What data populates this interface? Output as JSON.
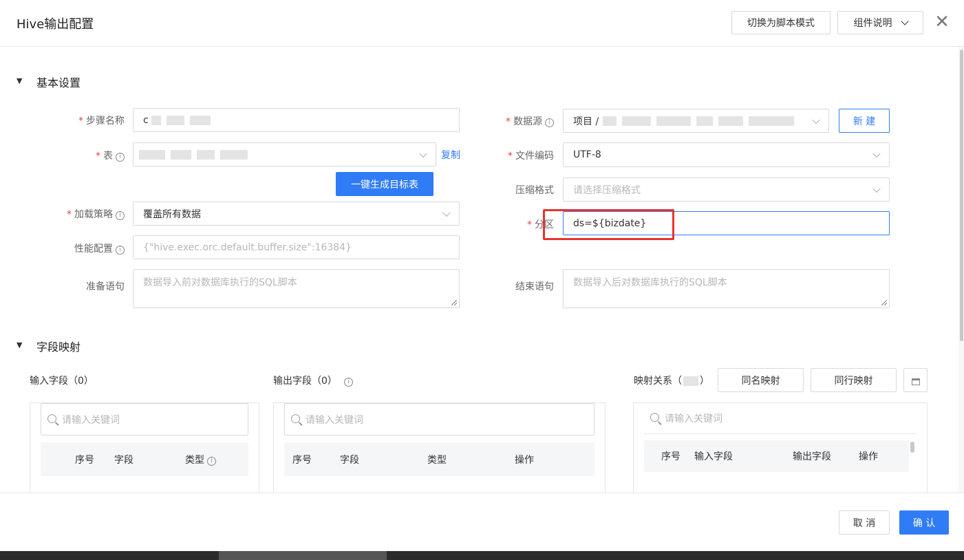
{
  "header": {
    "title": "Hive输出配置",
    "script_mode_label": "切换为脚本模式",
    "component_help_label": "组件说明",
    "close_glyph": "✕"
  },
  "basic": {
    "section_title": "基本设置",
    "step_name": {
      "label": "步骤名称",
      "value_prefix": "c"
    },
    "table": {
      "label": "表",
      "copy_label": "复制",
      "generate_label": "一键生成目标表"
    },
    "load_strategy": {
      "label": "加载策略",
      "value": "覆盖所有数据"
    },
    "perf_config": {
      "label": "性能配置",
      "placeholder": "{\"hive.exec.orc.default.buffer.size\":16384}"
    },
    "pre_sql": {
      "label": "准备语句",
      "placeholder": "数据导入前对数据库执行的SQL脚本"
    },
    "datasource": {
      "label": "数据源",
      "value_prefix": "项目 /",
      "new_label": "新 建"
    },
    "encoding": {
      "label": "文件编码",
      "value": "UTF-8"
    },
    "compression": {
      "label": "压缩格式",
      "placeholder": "请选择压缩格式"
    },
    "partition": {
      "label": "分区",
      "value": "ds=${bizdate}"
    },
    "post_sql": {
      "label": "结束语句",
      "placeholder": "数据导入后对数据库执行的SQL脚本"
    }
  },
  "mapping": {
    "section_title": "字段映射",
    "input": {
      "title": "输入字段（0）",
      "search_placeholder": "请输入关键词",
      "headers": [
        "序号",
        "字段",
        "类型"
      ]
    },
    "output": {
      "title": "输出字段（0）",
      "search_placeholder": "请输入关键词",
      "headers": [
        "序号",
        "字段",
        "类型",
        "操作"
      ]
    },
    "relation": {
      "title_prefix": "映射关系（",
      "title_suffix": "）",
      "same_name_label": "同名映射",
      "same_row_label": "同行映射",
      "search_placeholder": "请输入关键词",
      "headers": [
        "序号",
        "输入字段",
        "输出字段",
        "操作"
      ]
    }
  },
  "footer": {
    "cancel_label": "取 消",
    "confirm_label": "确 认"
  },
  "colors": {
    "primary": "#2f7cf6",
    "required": "#e64545",
    "highlight_box": "#e8322d"
  }
}
